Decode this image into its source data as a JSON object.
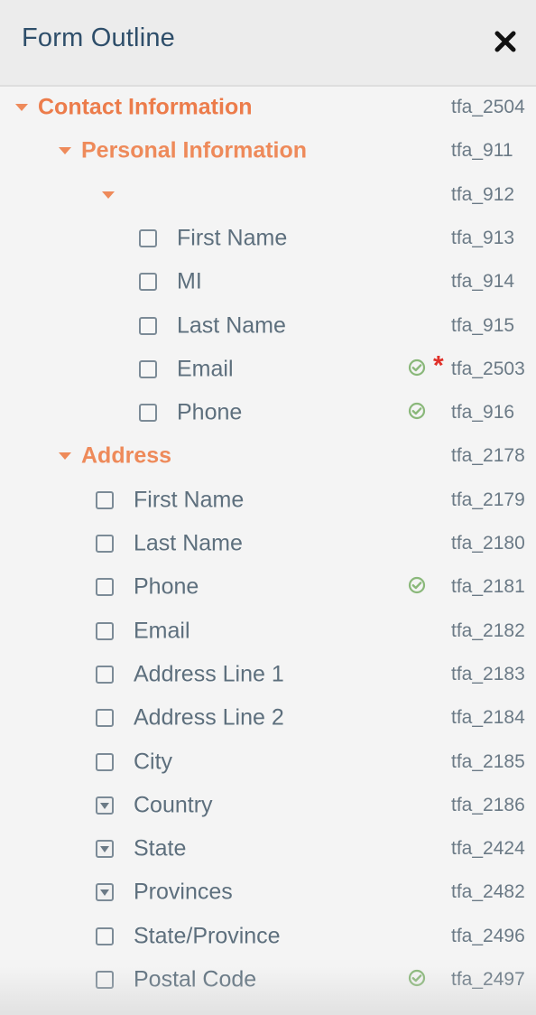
{
  "header": {
    "title": "Form Outline",
    "close_icon": "close-x-icon"
  },
  "colors": {
    "header_bg": "#ececec",
    "body_bg": "#f4f4f4",
    "title_color": "#2e4e6a",
    "group_color": "#ee8a5a",
    "field_color": "#5d6f7d",
    "check_color": "#8ab87a",
    "required_color": "#e0312a"
  },
  "rows": [
    {
      "kind": "group",
      "level": 0,
      "label": "Contact Information",
      "id": "tfa_2504",
      "expanded": true
    },
    {
      "kind": "group",
      "level": 1,
      "label": "Personal Information",
      "id": "tfa_911",
      "expanded": true
    },
    {
      "kind": "group",
      "level": 2,
      "label": "",
      "id": "tfa_912",
      "expanded": true
    },
    {
      "kind": "field",
      "level": 3,
      "label": "First Name",
      "id": "tfa_913",
      "input": "text"
    },
    {
      "kind": "field",
      "level": 3,
      "label": "MI",
      "id": "tfa_914",
      "input": "text"
    },
    {
      "kind": "field",
      "level": 3,
      "label": "Last Name",
      "id": "tfa_915",
      "input": "text"
    },
    {
      "kind": "field",
      "level": 3,
      "label": "Email",
      "id": "tfa_2503",
      "input": "text",
      "validated": true,
      "required": "*"
    },
    {
      "kind": "field",
      "level": 3,
      "label": "Phone",
      "id": "tfa_916",
      "input": "text",
      "validated": true
    },
    {
      "kind": "group",
      "level": 1,
      "label": "Address",
      "id": "tfa_2178",
      "expanded": true
    },
    {
      "kind": "field",
      "level": 2,
      "label": "First Name",
      "id": "tfa_2179",
      "input": "text"
    },
    {
      "kind": "field",
      "level": 2,
      "label": "Last Name",
      "id": "tfa_2180",
      "input": "text"
    },
    {
      "kind": "field",
      "level": 2,
      "label": "Phone",
      "id": "tfa_2181",
      "input": "text",
      "validated": true
    },
    {
      "kind": "field",
      "level": 2,
      "label": "Email",
      "id": "tfa_2182",
      "input": "text"
    },
    {
      "kind": "field",
      "level": 2,
      "label": "Address Line 1",
      "id": "tfa_2183",
      "input": "text"
    },
    {
      "kind": "field",
      "level": 2,
      "label": "Address Line 2",
      "id": "tfa_2184",
      "input": "text"
    },
    {
      "kind": "field",
      "level": 2,
      "label": "City",
      "id": "tfa_2185",
      "input": "text"
    },
    {
      "kind": "field",
      "level": 2,
      "label": "Country",
      "id": "tfa_2186",
      "input": "select"
    },
    {
      "kind": "field",
      "level": 2,
      "label": "State",
      "id": "tfa_2424",
      "input": "select"
    },
    {
      "kind": "field",
      "level": 2,
      "label": "Provinces",
      "id": "tfa_2482",
      "input": "select"
    },
    {
      "kind": "field",
      "level": 2,
      "label": "State/Province",
      "id": "tfa_2496",
      "input": "text"
    },
    {
      "kind": "field",
      "level": 2,
      "label": "Postal Code",
      "id": "tfa_2497",
      "input": "text",
      "validated": true
    }
  ]
}
